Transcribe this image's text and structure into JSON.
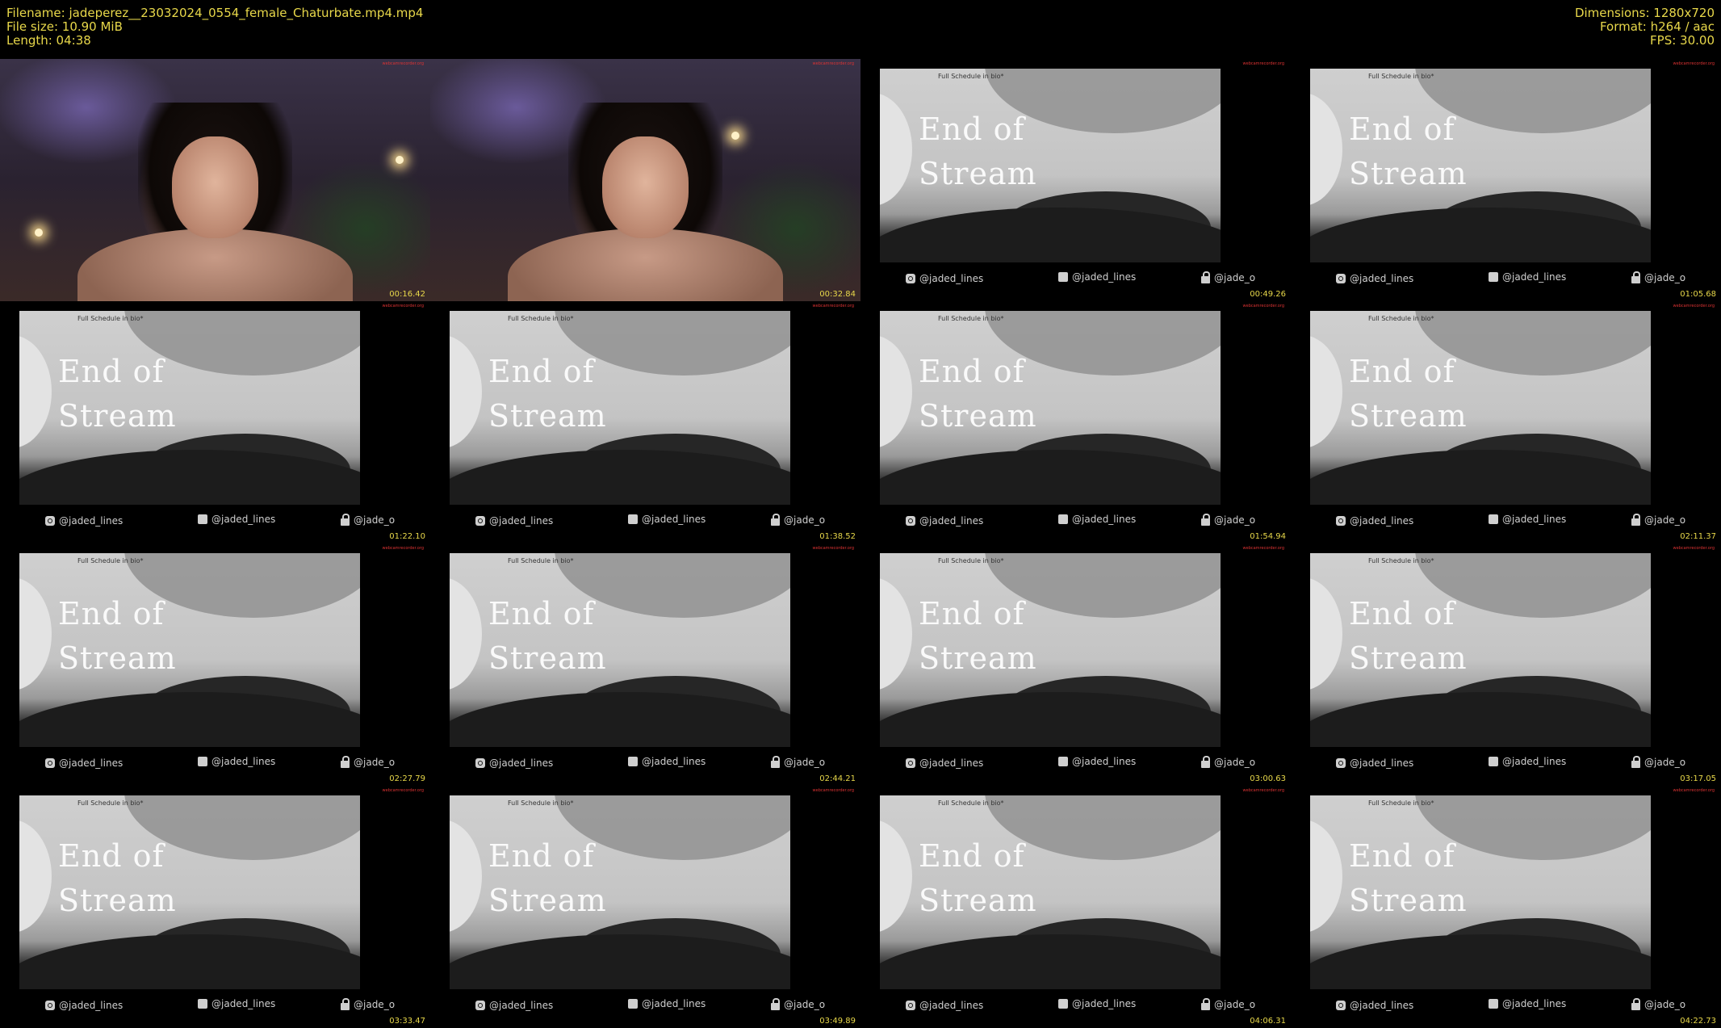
{
  "header": {
    "filename": "Filename: jadeperez__23032024_0554_female_Chaturbate.mp4.mp4",
    "filesize": "File size: 10.90 MiB",
    "length": "Length: 04:38",
    "dimensions": "Dimensions: 1280x720",
    "format": "Format: h264 / aac",
    "fps": "FPS: 30.00"
  },
  "slide": {
    "schedule": "Full Schedule in bio*",
    "title_line1": "End of",
    "title_line2": "Stream",
    "instagram": "@jaded_lines",
    "twitter": "@jaded_lines",
    "onlyfans": "@jade_o",
    "watermark": "webcamrecorder.org"
  },
  "thumbnails": [
    {
      "kind": "cam",
      "timestamp": "00:16.42"
    },
    {
      "kind": "cam",
      "timestamp": "00:32.84"
    },
    {
      "kind": "slide",
      "timestamp": "00:49.26"
    },
    {
      "kind": "slide",
      "timestamp": "01:05.68"
    },
    {
      "kind": "slide",
      "timestamp": "01:22.10"
    },
    {
      "kind": "slide",
      "timestamp": "01:38.52"
    },
    {
      "kind": "slide",
      "timestamp": "01:54.94"
    },
    {
      "kind": "slide",
      "timestamp": "02:11.37"
    },
    {
      "kind": "slide",
      "timestamp": "02:27.79"
    },
    {
      "kind": "slide",
      "timestamp": "02:44.21"
    },
    {
      "kind": "slide",
      "timestamp": "03:00.63"
    },
    {
      "kind": "slide",
      "timestamp": "03:17.05"
    },
    {
      "kind": "slide",
      "timestamp": "03:33.47"
    },
    {
      "kind": "slide",
      "timestamp": "03:49.89"
    },
    {
      "kind": "slide",
      "timestamp": "04:06.31"
    },
    {
      "kind": "slide",
      "timestamp": "04:22.73"
    }
  ]
}
